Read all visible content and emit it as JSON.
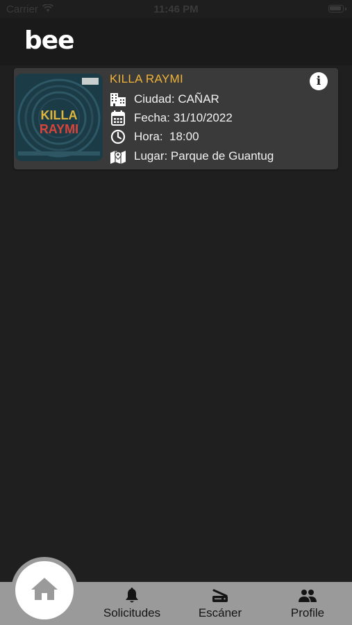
{
  "status_bar": {
    "carrier": "Carrier",
    "time": "11:46 PM"
  },
  "header": {
    "logo_text": "bee"
  },
  "events": [
    {
      "title": "KILLA RAYMI",
      "city": "Ciudad: CAÑAR",
      "date": "Fecha: 31/10/2022",
      "time": "Hora:  18:00",
      "place": "Lugar: Parque de Guantug",
      "poster_title_line1": "KILLA",
      "poster_title_line2": "RAYMI",
      "icons": {
        "info": "info-icon",
        "city": "city-buildings-icon",
        "date": "calendar-icon",
        "time": "clock-icon",
        "place": "map-pin-icon"
      }
    }
  ],
  "bottom_nav": {
    "home_icon": "home-icon",
    "items": [
      {
        "label": "Solicitudes",
        "icon": "bell-icon"
      },
      {
        "label": "Escáner",
        "icon": "scanner-icon"
      },
      {
        "label": "Profile",
        "icon": "people-icon"
      }
    ]
  },
  "colors": {
    "background": "#1f1f1f",
    "header": "#1a1a1a",
    "card": "#3a3a3a",
    "title_accent": "#f0b43a",
    "bottom_nav": "#9a9a9a",
    "nav_text": "#141414"
  }
}
